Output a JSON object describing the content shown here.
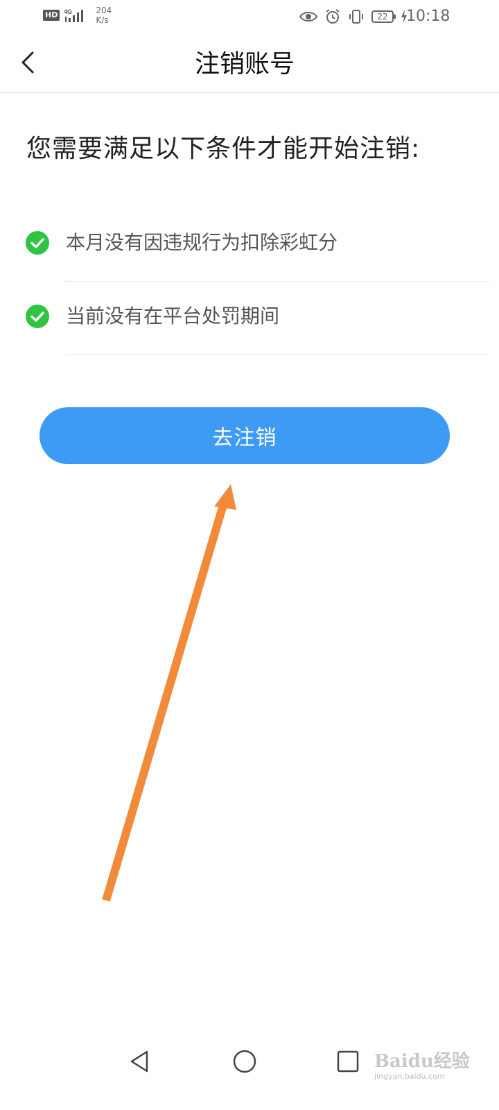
{
  "status_bar": {
    "hd": "HD",
    "network": "4G",
    "speed_value": "204",
    "speed_unit": "K/s",
    "battery": "22",
    "time": "10:18"
  },
  "header": {
    "title": "注销账号"
  },
  "main": {
    "heading": "您需要满足以下条件才能开始注销:",
    "conditions": [
      {
        "text": "本月没有因违规行为扣除彩虹分",
        "status": "met"
      },
      {
        "text": "当前没有在平台处罚期间",
        "status": "met"
      }
    ],
    "action_button": "去注销"
  },
  "watermark": {
    "logo": "Baidu经验",
    "url": "jingyan.baidu.com"
  },
  "colors": {
    "accent": "#3d9bf6",
    "check": "#2fc543",
    "arrow": "#f28a3b"
  }
}
